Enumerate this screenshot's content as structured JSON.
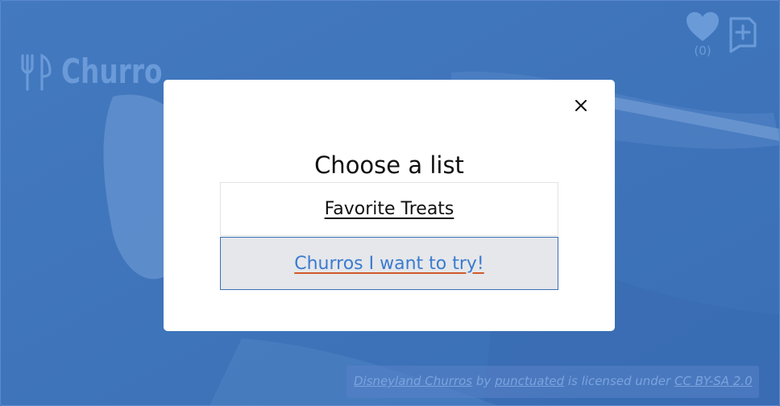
{
  "app": {
    "title": "Churro"
  },
  "header": {
    "favorites_count": "(0)"
  },
  "modal": {
    "title": "Choose a list",
    "close_icon": "close-icon",
    "lists": [
      {
        "label": "Favorite Treats"
      },
      {
        "label": "Churros I want to try!"
      }
    ]
  },
  "attribution": {
    "work": "Disneyland Churros",
    "by": "by",
    "author": "punctuated",
    "licensed": "is licensed under",
    "license": "CC BY-SA 2.0"
  },
  "colors": {
    "background": "#3f76bd",
    "modal": "#ffffff",
    "accent_link": "#3b7bd0",
    "underline_highlight": "#d15a2a"
  }
}
